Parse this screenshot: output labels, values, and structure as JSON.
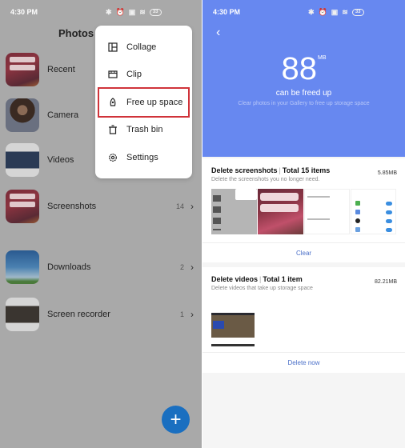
{
  "left": {
    "status": {
      "time": "4:30 PM",
      "icons": [
        "bluetooth-icon",
        "alarm-icon",
        "screenshot-icon",
        "wifi-icon"
      ],
      "battery": "33"
    },
    "title": "Photos",
    "albums": [
      {
        "name": "Recent",
        "count": ""
      },
      {
        "name": "Camera",
        "count": ""
      },
      {
        "name": "Videos",
        "count": ""
      },
      {
        "name": "Screenshots",
        "count": "14"
      },
      {
        "name": "Downloads",
        "count": "2"
      },
      {
        "name": "Screen recorder",
        "count": "1"
      }
    ],
    "menu": [
      {
        "label": "Collage",
        "icon": "collage-icon"
      },
      {
        "label": "Clip",
        "icon": "clip-icon"
      },
      {
        "label": "Free up space",
        "icon": "rocket-icon",
        "highlighted": true
      },
      {
        "label": "Trash bin",
        "icon": "trash-icon"
      },
      {
        "label": "Settings",
        "icon": "gear-icon"
      }
    ],
    "fab": "+",
    "colors": {
      "fab": "#1a6fc0",
      "highlight": "#d0333a"
    }
  },
  "right": {
    "status": {
      "time": "4:30 PM",
      "battery": "33"
    },
    "back": "‹",
    "amount": "88",
    "unit": "MB",
    "freed_label": "can be freed up",
    "subtitle": "Clear photos in your Gallery to free up storage space",
    "colors": {
      "hero": "#6788f0",
      "action": "#4a6fc8"
    },
    "cards": [
      {
        "title": "Delete screenshots",
        "total": "Total 15 items",
        "desc": "Delete the screenshots you no longer need.",
        "size": "5.85MB",
        "action": "Clear"
      },
      {
        "title": "Delete videos",
        "total": "Total 1 item",
        "desc": "Delete videos that take up storage space",
        "size": "82.21MB",
        "action": "Delete now"
      }
    ]
  }
}
